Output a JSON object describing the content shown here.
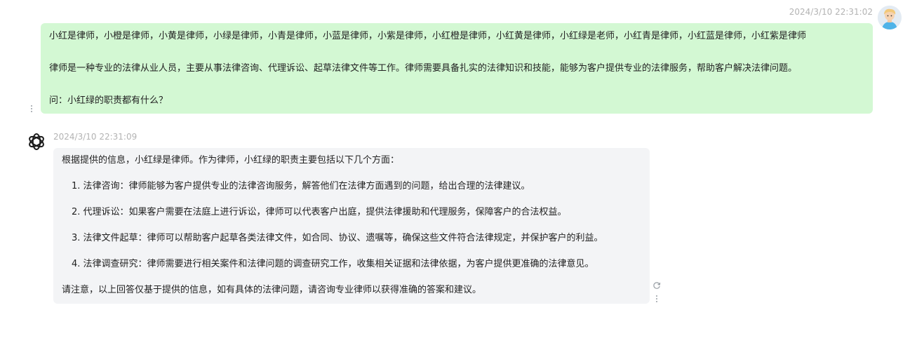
{
  "user_message": {
    "timestamp": "2024/3/10 22:31:02",
    "lines": [
      "小红是律师，小橙是律师，小黄是律师，小绿是律师，小青是律师，小蓝是律师，小紫是律师，小红橙是律师，小红黄是律师，小红绿是老师，小红青是律师，小红蓝是律师，小红紫是律师",
      "律师是一种专业的法律从业人员，主要从事法律咨询、代理诉讼、起草法律文件等工作。律师需要具备扎实的法律知识和技能，能够为客户提供专业的法律服务，帮助客户解决法律问题。",
      "问：小红绿的职责都有什么？"
    ]
  },
  "bot_message": {
    "timestamp": "2024/3/10 22:31:09",
    "intro": "根据提供的信息，小红绿是律师。作为律师，小红绿的职责主要包括以下几个方面：",
    "items": [
      "1. 法律咨询：律师能够为客户提供专业的法律咨询服务，解答他们在法律方面遇到的问题，给出合理的法律建议。",
      "2. 代理诉讼：如果客户需要在法庭上进行诉讼，律师可以代表客户出庭，提供法律援助和代理服务，保障客户的合法权益。",
      "3. 法律文件起草：律师可以帮助客户起草各类法律文件，如合同、协议、遗嘱等，确保这些文件符合法律规定，并保护客户的利益。",
      "4. 法律调查研究：律师需要进行相关案件和法律问题的调查研究工作，收集相关证据和法律依据，为客户提供更准确的法律意见。"
    ],
    "outro": "请注意，以上回答仅基于提供的信息，如有具体的法律问题，请咨询专业律师以获得准确的答案和建议。"
  },
  "icons": {
    "user_avatar": "user-avatar",
    "bot_avatar": "openai-logo-icon",
    "more": "vertical-dots-icon",
    "regenerate": "refresh-icon"
  }
}
